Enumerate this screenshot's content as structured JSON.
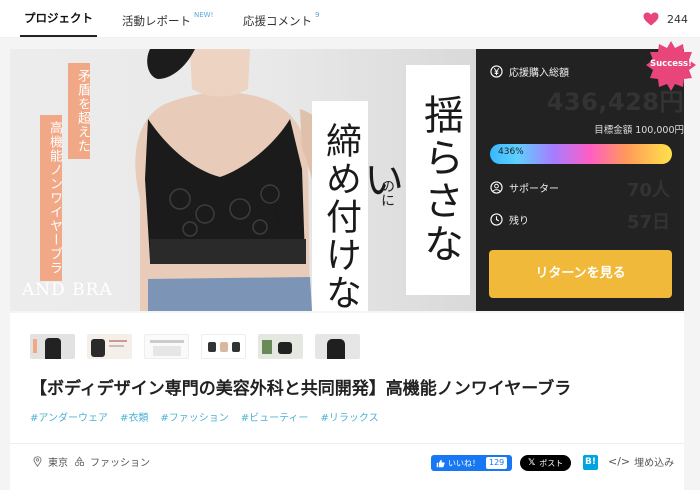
{
  "tabs": [
    {
      "label": "プロジェクト",
      "badge": ""
    },
    {
      "label": "活動レポート",
      "badge": "NEW!"
    },
    {
      "label": "応援コメント",
      "badge": "9"
    }
  ],
  "likes": {
    "count": "244"
  },
  "hero": {
    "side_text_1": "矛盾を超えた",
    "side_text_2": "高機能ノンワイヤーブラ",
    "vertical_1": "揺らさない",
    "connector": "のに",
    "vertical_2": "締め付けない",
    "brand": "AND BRA"
  },
  "panel": {
    "raised_label": "応援購入総額",
    "amount": "436,428円",
    "goal": "目標金額 100,000円",
    "progress_text": "436%",
    "progress_percent": 436,
    "supporters_label": "サポーター",
    "supporters_value": "70人",
    "days_label": "残り",
    "days_value": "57日",
    "cta_label": "リターンを見る",
    "badge": "Success!"
  },
  "project": {
    "title": "【ボディデザイン専門の美容外科と共同開発】高機能ノンワイヤーブラ",
    "tags": [
      "#アンダーウェア",
      "#衣類",
      "#ファッション",
      "#ビューティー",
      "#リラックス"
    ],
    "location": "東京",
    "category": "ファッション"
  },
  "share": {
    "fb_label": "いいね！",
    "fb_count": "129",
    "x_label": "ポスト",
    "hatena": "B!",
    "embed_label": "埋め込み"
  },
  "colors": {
    "accent": "#f0b93a",
    "tag": "#4db3d6",
    "badge": "#e8457a",
    "heart": "#e8457a"
  }
}
